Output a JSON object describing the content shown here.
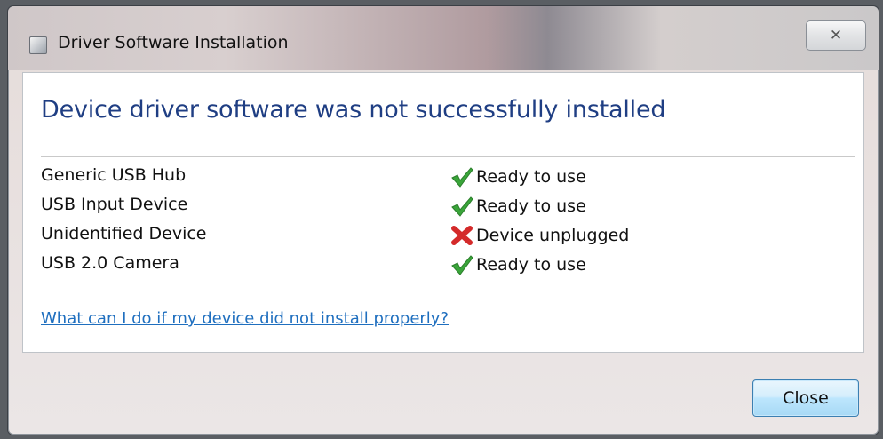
{
  "window": {
    "title": "Driver Software Installation",
    "close_glyph": "✕"
  },
  "heading": "Device driver software was not successfully installed",
  "devices": [
    {
      "name": "Generic USB Hub",
      "status": "Ready to use",
      "status_icon": "check-icon"
    },
    {
      "name": "USB Input Device",
      "status": "Ready to use",
      "status_icon": "check-icon"
    },
    {
      "name": "Unidentified Device",
      "status": "Device unplugged",
      "status_icon": "error-x-icon"
    },
    {
      "name": "USB 2.0 Camera",
      "status": "Ready to use",
      "status_icon": "check-icon"
    }
  ],
  "help_link": "What can I do if my device did not install properly?",
  "buttons": {
    "close_label": "Close"
  },
  "colors": {
    "heading": "#1f3e83",
    "link": "#1f6fbf",
    "check": "#3aa53a",
    "error": "#d42a2a"
  }
}
